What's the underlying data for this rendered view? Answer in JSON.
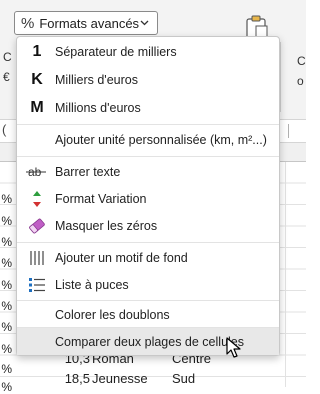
{
  "ribbon": {
    "formats_button": {
      "icon": "percent-icon",
      "label": "Formats avancés",
      "chevron": "⌄"
    },
    "left_edge_letters": [
      "C",
      "€"
    ],
    "right_group_letters": [
      "C",
      "o"
    ],
    "clipboard_icon": "clipboard-icon"
  },
  "formula_bar": {
    "prefix": "("
  },
  "sheet": {
    "left_percent_cells": [
      "%",
      "%",
      "%",
      "%",
      "%",
      "%",
      "%",
      "%",
      "%",
      "%"
    ],
    "visible_rows": [
      {
        "value": "10,3",
        "genre": "Roman",
        "region": "Centre"
      },
      {
        "value": "18,5",
        "genre": "Jeunesse",
        "region": "Sud"
      }
    ]
  },
  "menu": {
    "items": [
      {
        "icon": "digit-one-icon",
        "glyph": "1",
        "label": "Séparateur de milliers"
      },
      {
        "icon": "thousands-k-icon",
        "glyph": "K",
        "label": "Milliers d'euros"
      },
      {
        "icon": "millions-m-icon",
        "glyph": "M",
        "label": "Millions d'euros"
      },
      {
        "icon": "none",
        "glyph": "",
        "label": "Ajouter unité personnalisée (km, m²...)"
      },
      {
        "icon": "strikethrough-icon",
        "glyph": "ab",
        "label": "Barrer texte"
      },
      {
        "icon": "variation-arrows-icon",
        "glyph": "",
        "label": "Format Variation"
      },
      {
        "icon": "eraser-icon",
        "glyph": "",
        "label": "Masquer les zéros"
      },
      {
        "icon": "vertical-lines-pattern-icon",
        "glyph": "",
        "label": "Ajouter un motif de fond"
      },
      {
        "icon": "bullet-list-icon",
        "glyph": "",
        "label": "Liste à puces"
      },
      {
        "icon": "none",
        "glyph": "",
        "label": "Colorer les doublons"
      },
      {
        "icon": "none",
        "glyph": "",
        "label": "Comparer deux plages de cellules"
      }
    ],
    "highlighted_index": 10
  },
  "colors": {
    "menu_bg": "#ffffff",
    "highlight_bg": "#e8e8e8",
    "arrow_up": "#2e9e3e",
    "arrow_down": "#d23232",
    "eraser": "#c05ec6",
    "list_icon": "#1e6fc0"
  }
}
